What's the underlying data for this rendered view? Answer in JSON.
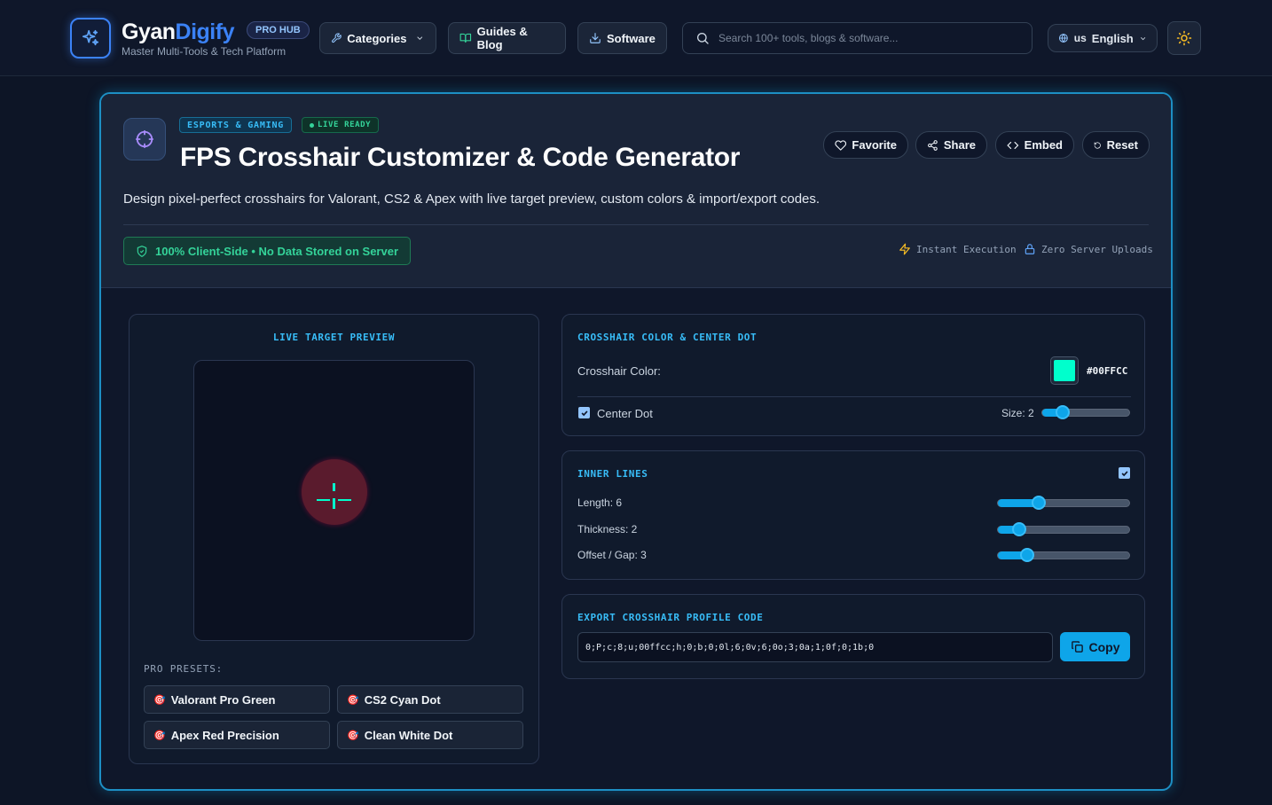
{
  "header": {
    "brand_a": "Gyan",
    "brand_b": "Digify",
    "tagline": "Master Multi-Tools & Tech Platform",
    "pro_badge": "PRO HUB",
    "nav": {
      "categories": "Categories",
      "guides": "Guides & Blog",
      "software": "Software"
    },
    "search_placeholder": "Search 100+ tools, blogs & software...",
    "lang_flag": "us",
    "lang_label": "English"
  },
  "tool": {
    "badge_category": "ESPORTS & GAMING",
    "badge_live": "LIVE READY",
    "title": "FPS Crosshair Customizer & Code Generator",
    "description": "Design pixel-perfect crosshairs for Valorant, CS2 & Apex with live target preview, custom colors & import/export codes.",
    "actions": {
      "favorite": "Favorite",
      "share": "Share",
      "embed": "Embed",
      "reset": "Reset"
    },
    "client_badge": "100% Client-Side • No Data Stored on Server",
    "meta_instant": "Instant Execution",
    "meta_uploads": "Zero Server Uploads"
  },
  "preview": {
    "label": "LIVE TARGET PREVIEW",
    "presets_label": "PRO PRESETS:",
    "presets": [
      "Valorant Pro Green",
      "CS2 Cyan Dot",
      "Apex Red Precision",
      "Clean White Dot"
    ]
  },
  "color_panel": {
    "label": "CROSSHAIR COLOR & CENTER DOT",
    "color_label": "Crosshair Color:",
    "color_value": "#00FFCC",
    "center_dot_label": "Center Dot",
    "center_dot_checked": true,
    "size_label": "Size: 2",
    "size_value": 2
  },
  "inner_lines": {
    "label": "INNER LINES",
    "enabled": true,
    "length_label": "Length: 6",
    "length_value": 6,
    "thickness_label": "Thickness: 2",
    "thickness_value": 2,
    "offset_label": "Offset / Gap: 3",
    "offset_value": 3
  },
  "export": {
    "label": "EXPORT CROSSHAIR PROFILE CODE",
    "code": "0;P;c;8;u;00ffcc;h;0;b;0;0l;6;0v;6;0o;3;0a;1;0f;0;1b;0",
    "copy_label": "Copy"
  },
  "colors": {
    "accent": "#0ea5e9",
    "brand_blue": "#3b82f6",
    "success": "#34d399",
    "crosshair": "#00ffcc",
    "target": "#5a1b2d",
    "background": "#0d1526"
  }
}
